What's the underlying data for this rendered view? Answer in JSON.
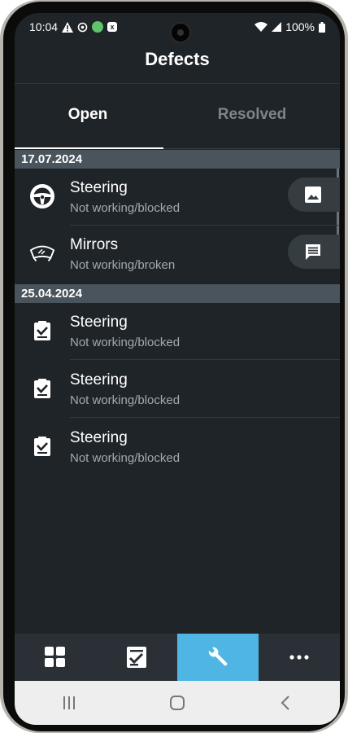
{
  "status_bar": {
    "time": "10:04",
    "battery": "100%",
    "left_icons": [
      "warning-icon",
      "sync-icon",
      "app-notification-icon",
      "sim-icon"
    ],
    "right_icons": [
      "wifi-icon",
      "signal-icon",
      "battery-icon"
    ]
  },
  "header": {
    "title": "Defects"
  },
  "tabs": [
    {
      "label": "Open",
      "active": true
    },
    {
      "label": "Resolved",
      "active": false
    }
  ],
  "sections": [
    {
      "date": "17.07.2024",
      "items": [
        {
          "title": "Steering",
          "subtitle": "Not working/blocked",
          "icon": "steering-wheel-icon",
          "action_icon": "image-icon"
        },
        {
          "title": "Mirrors",
          "subtitle": "Not working/broken",
          "icon": "mirror-icon",
          "action_icon": "comment-icon"
        }
      ]
    },
    {
      "date": "25.04.2024",
      "items": [
        {
          "title": "Steering",
          "subtitle": "Not working/blocked",
          "icon": "checklist-icon"
        },
        {
          "title": "Steering",
          "subtitle": "Not working/blocked",
          "icon": "checklist-icon"
        },
        {
          "title": "Steering",
          "subtitle": "Not working/blocked",
          "icon": "checklist-icon"
        }
      ]
    }
  ],
  "bottom_nav": [
    {
      "icon": "dashboard-grid-icon",
      "active": false
    },
    {
      "icon": "checklist-icon",
      "active": false
    },
    {
      "icon": "wrench-icon",
      "active": true
    },
    {
      "icon": "more-dots-icon",
      "active": false
    }
  ],
  "system_nav": [
    "recent-apps-icon",
    "home-icon",
    "back-icon"
  ],
  "colors": {
    "background": "#1f2428",
    "section_header": "#4a545c",
    "active_tab_accent": "#4fb6e3",
    "subtitle_text": "#a3a9ae"
  }
}
